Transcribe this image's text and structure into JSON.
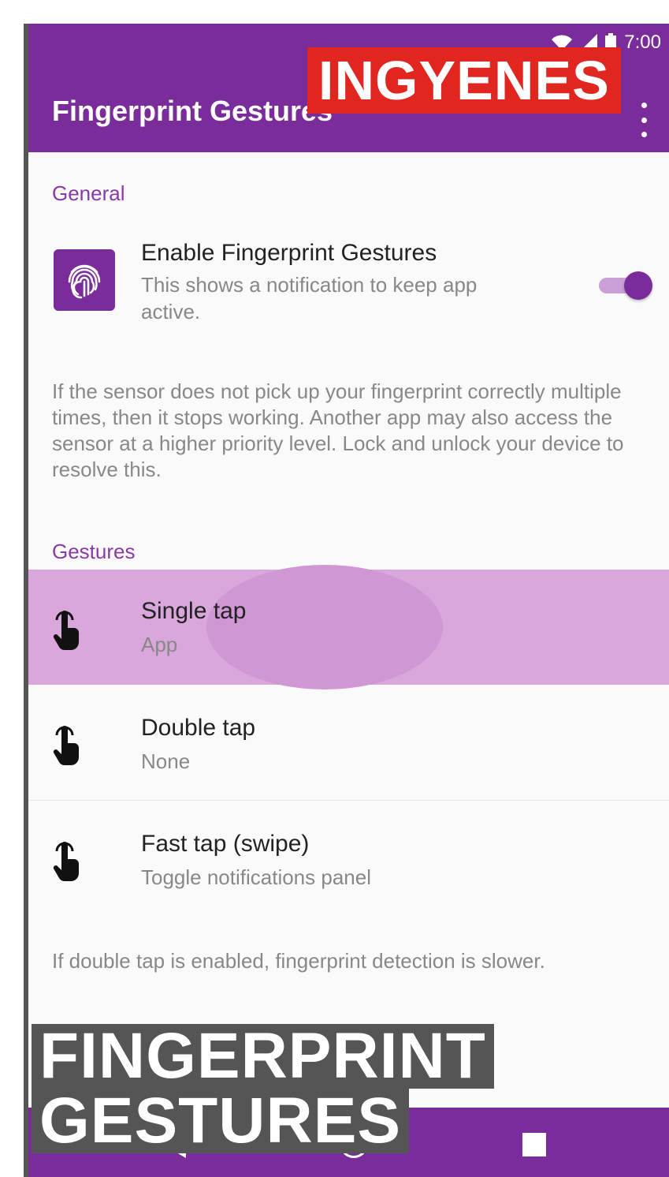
{
  "app": {
    "title": "Fingerprint Gestures",
    "status_time": "7:00",
    "badge": "INGYENES"
  },
  "general": {
    "header": "General",
    "enable": {
      "title": "Enable Fingerprint Gestures",
      "subtitle": "This shows a notification to keep app active.",
      "enabled": true
    },
    "info": "If the sensor does not pick up your fingerprint correctly multiple times, then it stops working. Another app may also access the sensor at a higher priority level. Lock and unlock your device to resolve this."
  },
  "gestures": {
    "header": "Gestures",
    "items": [
      {
        "title": "Single tap",
        "value": "App"
      },
      {
        "title": "Double tap",
        "value": "None"
      },
      {
        "title": "Fast tap (swipe)",
        "value": "Toggle notifications panel"
      }
    ],
    "note": "If double tap is enabled, fingerprint detection is slower."
  },
  "caption": {
    "line1": "FINGERPRINT",
    "line2": "GESTURES"
  },
  "colors": {
    "primary": "#7a2c9a",
    "accent": "#8a3aa6",
    "badge": "#e0261f"
  }
}
